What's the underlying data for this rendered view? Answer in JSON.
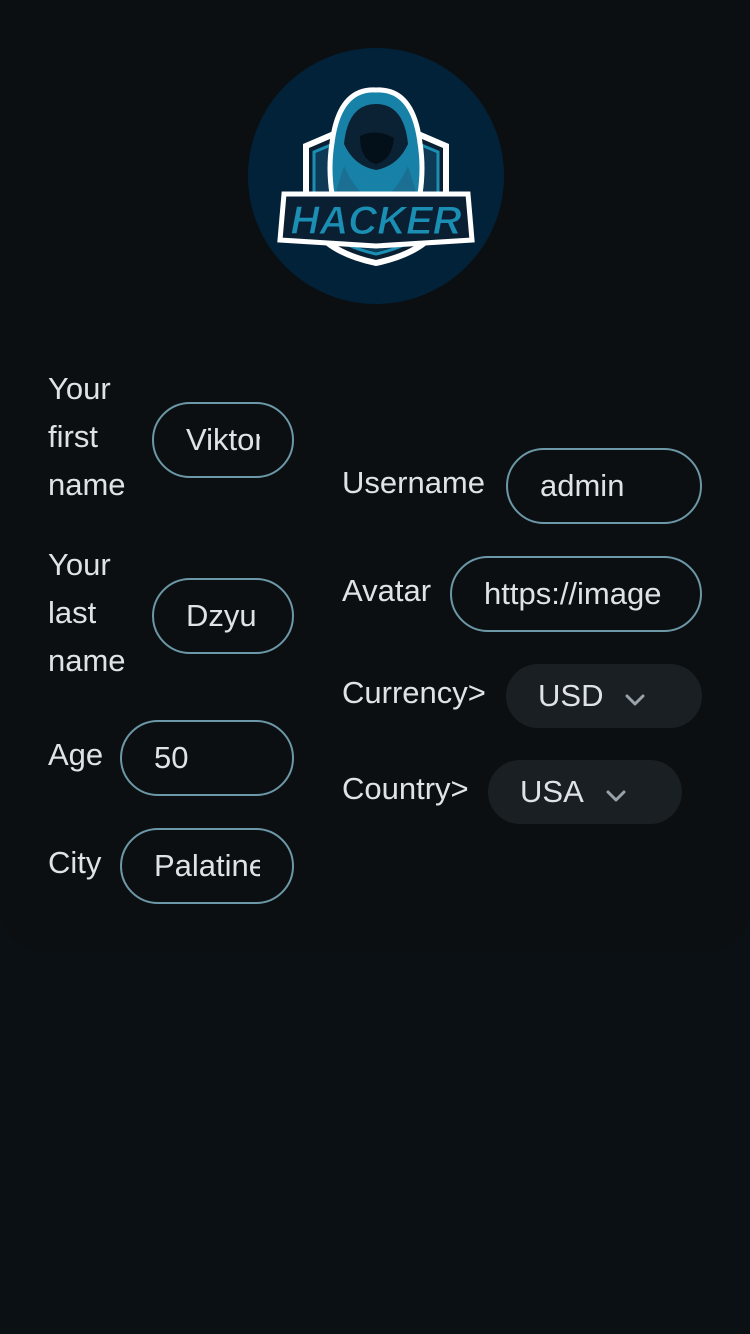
{
  "profile": {
    "logo_text": "HACKER",
    "fields": {
      "first_name": {
        "label_lines": [
          "Your",
          "first",
          "name"
        ],
        "value": "Viktor"
      },
      "last_name": {
        "label_lines": [
          "Your",
          "last",
          "name"
        ],
        "value": "Dzyu"
      },
      "age": {
        "label": "Age",
        "value": "50"
      },
      "city": {
        "label": "City",
        "value": "Palatine"
      },
      "username": {
        "label": "Username",
        "value": "admin"
      },
      "avatar": {
        "label": "Avatar",
        "value": "https://image"
      },
      "currency": {
        "label": "Currency>",
        "value": "USD"
      },
      "country": {
        "label": "Country>",
        "value": "USA"
      }
    }
  },
  "colors": {
    "background": "#0b1014",
    "logo_bg": "#02223a",
    "accent": "#1a8fb3",
    "field_border": "#6c97a6",
    "select_bg": "#1a1f24"
  },
  "icons": {
    "logo": "hacker-hood-shield-icon",
    "dropdown": "chevron-down-icon"
  }
}
